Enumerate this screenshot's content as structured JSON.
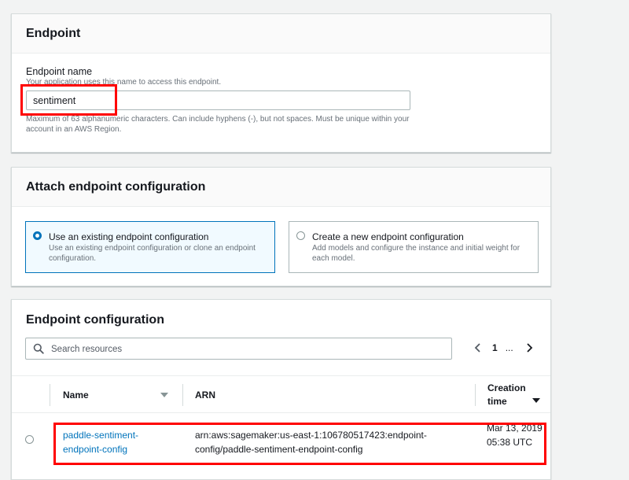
{
  "endpoint_section": {
    "title": "Endpoint",
    "name_label": "Endpoint name",
    "name_description": "Your application uses this name to access this endpoint.",
    "name_value": "sentiment",
    "name_constraint": "Maximum of 63 alphanumeric characters. Can include hyphens (-), but not spaces. Must be unique within your account in an AWS Region."
  },
  "attach_section": {
    "title": "Attach endpoint configuration",
    "options": [
      {
        "title": "Use an existing endpoint configuration",
        "description": "Use an existing endpoint configuration or clone an endpoint configuration.",
        "selected": true
      },
      {
        "title": "Create a new endpoint configuration",
        "description": "Add models and configure the instance and initial weight for each model.",
        "selected": false
      }
    ]
  },
  "config_section": {
    "title": "Endpoint configuration",
    "search_placeholder": "Search resources",
    "pagination": {
      "current_page": "1",
      "ellipsis": "..."
    },
    "columns": {
      "name": "Name",
      "arn": "ARN",
      "creation_time": "Creation time"
    },
    "rows": [
      {
        "name": "paddle-sentiment-endpoint-config",
        "arn": "arn:aws:sagemaker:us-east-1:106780517423:endpoint-config/paddle-sentiment-endpoint-config",
        "creation_time": "Mar 13, 2019 05:38 UTC"
      }
    ]
  },
  "colors": {
    "highlight": "#ff0000",
    "accent": "#0073bb",
    "background": "#f2f3f3"
  }
}
